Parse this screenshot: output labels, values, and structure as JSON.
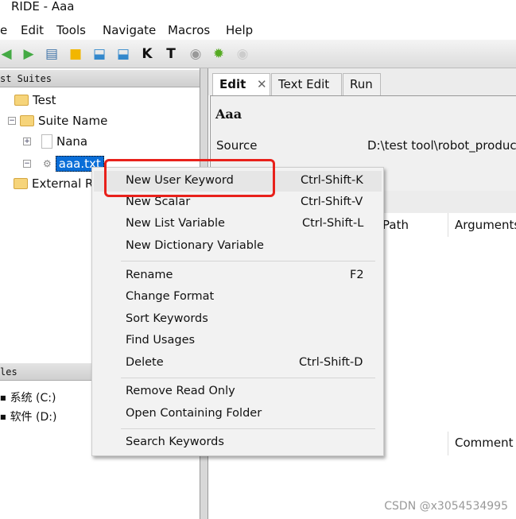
{
  "window": {
    "title": "RIDE - Aaa"
  },
  "menubar": [
    "e",
    "Edit",
    "Tools",
    "Navigate",
    "Macros",
    "Help"
  ],
  "toolbar": {
    "icons": [
      "back-arrow-icon",
      "forward-arrow-icon",
      "open-suite-icon",
      "open-folder-icon",
      "save-icon",
      "save-all-icon",
      "search-keyword-icon",
      "search-test-icon",
      "run-icon",
      "debug-bug-icon",
      "stop-icon"
    ]
  },
  "left": {
    "suites_header": "st Suites",
    "tree": [
      {
        "label": "Test"
      },
      {
        "label": "Suite Name"
      },
      {
        "label": "Nana"
      },
      {
        "label": "aaa.txt"
      },
      {
        "label": "External R"
      }
    ],
    "files_header": "les",
    "files": [
      {
        "label": "系统 (C:)"
      },
      {
        "label": "软件 (D:)"
      }
    ]
  },
  "tabs": [
    {
      "label": "Edit",
      "active": true
    },
    {
      "label": "Text Edit"
    },
    {
      "label": "Run"
    }
  ],
  "editor": {
    "name": "Aaa",
    "source_label": "Source",
    "source_value": "D:\\test tool\\robot_produc",
    "columns": [
      "Path",
      "Arguments"
    ],
    "comment_label": "Comment"
  },
  "context_menu": {
    "groups": [
      [
        {
          "label": "New User Keyword",
          "shortcut": "Ctrl-Shift-K"
        },
        {
          "label": "New Scalar",
          "shortcut": "Ctrl-Shift-V"
        },
        {
          "label": "New List Variable",
          "shortcut": "Ctrl-Shift-L"
        },
        {
          "label": "New Dictionary Variable",
          "shortcut": ""
        }
      ],
      [
        {
          "label": "Rename",
          "shortcut": "F2"
        },
        {
          "label": "Change Format",
          "shortcut": ""
        },
        {
          "label": "Sort Keywords",
          "shortcut": ""
        },
        {
          "label": "Find Usages",
          "shortcut": ""
        },
        {
          "label": "Delete",
          "shortcut": "Ctrl-Shift-D"
        }
      ],
      [
        {
          "label": "Remove Read Only",
          "shortcut": ""
        },
        {
          "label": "Open Containing Folder",
          "shortcut": ""
        }
      ],
      [
        {
          "label": "Search Keywords",
          "shortcut": ""
        }
      ]
    ],
    "highlight_color": "#e8211b"
  },
  "watermark": "CSDN @x3054534995"
}
